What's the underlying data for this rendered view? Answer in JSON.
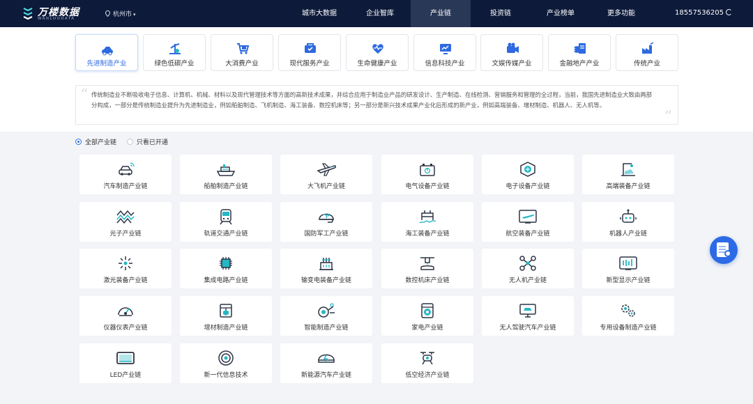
{
  "header": {
    "logo_title": "万楼数据",
    "logo_sub": "WANLOUDATA",
    "city": "杭州市",
    "nav": [
      "城市大数据",
      "企业智库",
      "产业链",
      "投资链",
      "产业榜单",
      "更多功能"
    ],
    "active_nav": "产业链",
    "phone": "18557536205"
  },
  "categories": [
    {
      "label": "先进制造产业",
      "icon": "car-factory-icon",
      "active": true
    },
    {
      "label": "绿色低碳产业",
      "icon": "wind-leaf-icon"
    },
    {
      "label": "大消费产业",
      "icon": "shopping-cart-icon"
    },
    {
      "label": "现代服务产业",
      "icon": "service-icon"
    },
    {
      "label": "生命健康产业",
      "icon": "heart-pulse-icon"
    },
    {
      "label": "信息科技产业",
      "icon": "monitor-chart-icon"
    },
    {
      "label": "文娱传媒产业",
      "icon": "camera-icon"
    },
    {
      "label": "金融地产产业",
      "icon": "coins-icon"
    },
    {
      "label": "传统产业",
      "icon": "factory-icon"
    }
  ],
  "description": "传统制造业不断吸收电子信息、计算机、机械、材料以及现代管理技术等方面的高新技术成果，并综合应用于制造业产品的研发设计、生产制造、在线检测、营销服务和管理的全过程，当前，我国先进制造业大致由两部分构成，一部分是传统制造业提升为先进制造业，例如船舶制造、飞机制造、海工装备、数控机床等；另一部分是新兴技术成果产业化后形成的新产业，例如高端装备、增材制造、机器人、无人机等。",
  "filters": {
    "all": "全部产业链",
    "opened": "只看已开通",
    "selected": "all"
  },
  "chains": [
    {
      "label": "汽车制造产业链",
      "icon": "connected-car-icon"
    },
    {
      "label": "船舶制造产业链",
      "icon": "ship-icon"
    },
    {
      "label": "大飞机产业链",
      "icon": "airplane-icon"
    },
    {
      "label": "电气设备产业链",
      "icon": "battery-icon"
    },
    {
      "label": "电子设备产业链",
      "icon": "chip-hexagon-icon"
    },
    {
      "label": "高端装备产业链",
      "icon": "robot-arm-icon"
    },
    {
      "label": "光子产业链",
      "icon": "photon-wave-icon"
    },
    {
      "label": "轨道交通产业链",
      "icon": "train-icon"
    },
    {
      "label": "国防军工产业链",
      "icon": "helmet-icon"
    },
    {
      "label": "海工装备产业链",
      "icon": "offshore-platform-icon"
    },
    {
      "label": "航空装备产业链",
      "icon": "aviation-screen-icon"
    },
    {
      "label": "机器人产业链",
      "icon": "robot-icon"
    },
    {
      "label": "激光装备产业链",
      "icon": "laser-icon"
    },
    {
      "label": "集成电路产业链",
      "icon": "integrated-circuit-icon"
    },
    {
      "label": "输变电装备产业链",
      "icon": "transformer-icon"
    },
    {
      "label": "数控机床产业链",
      "icon": "cnc-machine-icon"
    },
    {
      "label": "无人机产业链",
      "icon": "drone-icon"
    },
    {
      "label": "新型显示产业链",
      "icon": "display-panel-icon"
    },
    {
      "label": "仪器仪表产业链",
      "icon": "gauge-icon"
    },
    {
      "label": "增材制造产业链",
      "icon": "3d-printer-icon"
    },
    {
      "label": "智能制造产业链",
      "icon": "smart-gear-icon"
    },
    {
      "label": "家电产业链",
      "icon": "washing-machine-icon"
    },
    {
      "label": "无人驾驶汽车产业链",
      "icon": "autonomous-car-icon"
    },
    {
      "label": "专用设备制造产业链",
      "icon": "gears-icon"
    },
    {
      "label": "LED产业链",
      "icon": "led-panel-icon"
    },
    {
      "label": "新一代信息技术",
      "icon": "signal-target-icon"
    },
    {
      "label": "新能源汽车产业链",
      "icon": "ev-icon"
    },
    {
      "label": "低空经济产业链",
      "icon": "low-altitude-drone-icon"
    }
  ],
  "colors": {
    "nav_bg": "#0d1a3a",
    "accent": "#2e6ae0",
    "teal": "#25b7c4",
    "dark": "#2c3344"
  }
}
